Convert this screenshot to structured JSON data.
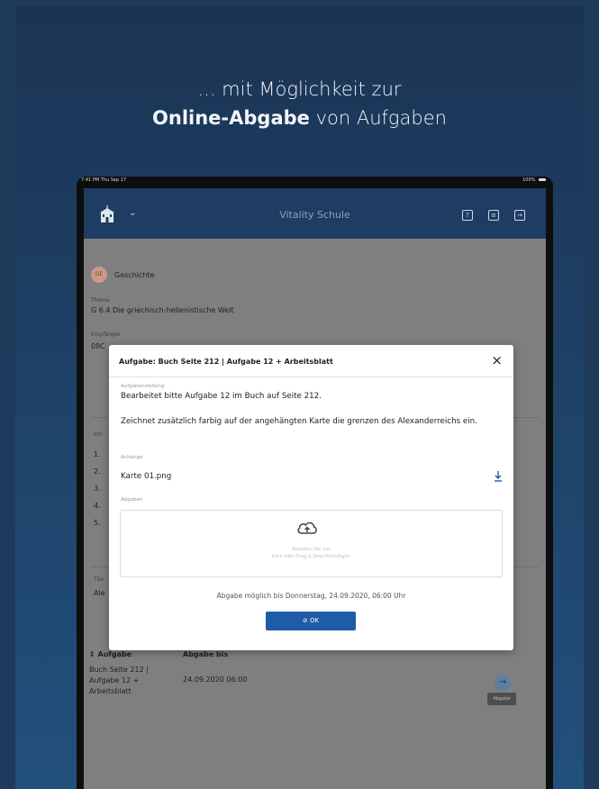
{
  "promo": {
    "line1": "... mit Möglichkeit zur",
    "line2_bold": "Online-Abgabe",
    "line2_rest": " von Aufgaben"
  },
  "statusbar": {
    "time": "7:41 PM  Thu Sep 17",
    "battery": "100%"
  },
  "appbar": {
    "title": "Vitality Schule",
    "icons": [
      "school-icon",
      "chevron-down-icon",
      "help-icon",
      "document-icon",
      "logout-icon"
    ]
  },
  "background": {
    "subject_badge": "GE",
    "subject": "Geschichte",
    "topic_label": "Thema",
    "topic": "G 6.4 Die griechisch-hellenistische Welt",
    "recipient_label": "Empfänger",
    "recipient_value": "08C",
    "content_label": "Inh",
    "numbers": [
      "1.",
      "2.",
      "3.",
      "4.",
      "5."
    ],
    "section2_label": "Tite",
    "section2_value": "Ale",
    "table_col1": "Aufgabe",
    "table_col2": "Abgabe bis",
    "row_task": [
      "Buch Seite 212 |",
      "Aufgabe 12 +",
      "Arbeitsblatt"
    ],
    "row_due": "24.09.2020 06:00",
    "tooltip": "Abgabe"
  },
  "modal": {
    "title": "Aufgabe: Buch Seite 212 | Aufgabe 12 + Arbeitsblatt",
    "task_label": "Aufgabenstellung",
    "task_line1": "Bearbeitet bitte Aufgabe 12 im Buch auf Seite 212.",
    "task_line2": "Zeichnet zusätzlich farbig auf der angehängten Karte die grenzen des Alexanderreichs ein.",
    "attachments_label": "Anhänge",
    "attachment_name": "Karte 01.png",
    "submissions_label": "Abgaben",
    "drop_hint1": "Abgaben hier per",
    "drop_hint2": "Klick oder Drag & Drop hinzufügen",
    "deadline": "Abgabe möglich bis Donnerstag, 24.09.2020, 06:00 Uhr",
    "ok_label": "OK"
  },
  "colors": {
    "appbar": "#1f3d63",
    "primary_button": "#1f5ca6",
    "backdrop": "#1b3454"
  }
}
